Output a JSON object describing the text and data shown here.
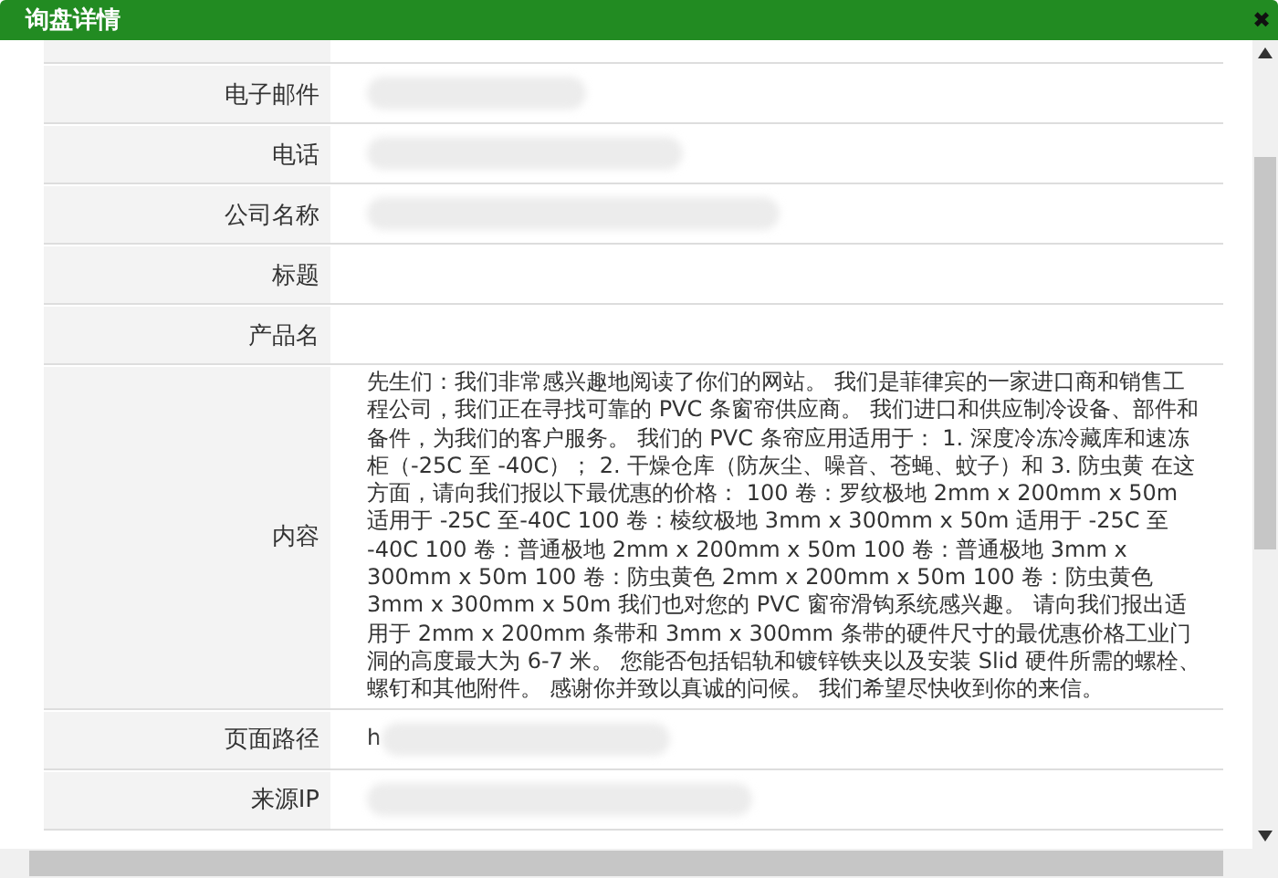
{
  "window": {
    "title": "询盘详情",
    "close": "✖"
  },
  "fields": [
    {
      "label": "电子邮件",
      "redacted": true
    },
    {
      "label": "电话",
      "redacted": true
    },
    {
      "label": "公司名称",
      "redacted": true
    },
    {
      "label": "标题"
    },
    {
      "label": "产品名"
    },
    {
      "label": "内容",
      "value": "先生们：我们非常感兴趣地阅读了你们的网站。 我们是菲律宾的一家进口商和销售工程公司，我们正在寻找可靠的 PVC 条窗帘供应商。 我们进口和供应制冷设备、部件和备件，为我们的客户服务。 我们的 PVC 条帘应用适用于： 1. 深度冷冻冷藏库和速冻柜（-25C 至 -40C）； 2. 干燥仓库（防灰尘、噪音、苍蝇、蚊子）和 3. 防虫黄 在这方面，请向我们报以下最优惠的价格： 100 卷：罗纹极地 2mm x 200mm x 50m 适用于 -25C 至-40C 100 卷：棱纹极地 3mm x 300mm x 50m 适用于 -25C 至 -40C 100 卷：普通极地 2mm x 200mm x 50m 100 卷：普通极地 3mm x 300mm x 50m 100 卷：防虫黄色 2mm x 200mm x 50m 100 卷：防虫黄色 3mm x 300mm x 50m 我们也对您的 PVC 窗帘滑钩系统感兴趣。 请向我们报出适用于 2mm x 200mm 条带和 3mm x 300mm 条带的硬件尺寸的最优惠价格工业门洞的高度最大为 6-7 米。 您能否包括铝轨和镀锌铁夹以及安装 Slid 硬件所需的螺栓、螺钉和其他附件。 感谢你并致以真诚的问候。 我们希望尽快收到你的来信。"
    },
    {
      "label": "页面路径",
      "value": "h",
      "redacted": true
    },
    {
      "label": "来源IP",
      "redacted": true
    }
  ]
}
